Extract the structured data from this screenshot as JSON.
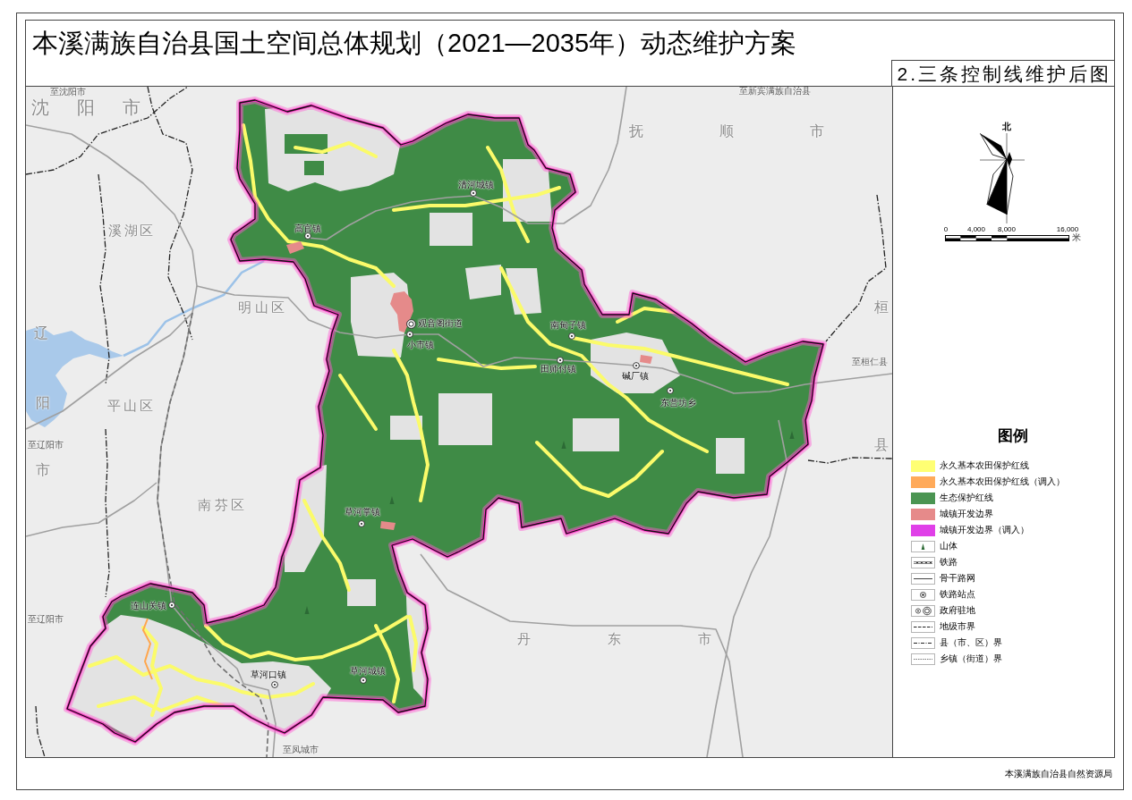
{
  "title": "本溪满族自治县国土空间总体规划（2021—2035年）动态维护方案",
  "subtitle": "2.三条控制线维护后图",
  "map": {
    "region_labels": [
      "沈阳市",
      "溪湖区",
      "明山区",
      "辽",
      "阳",
      "市",
      "平山区",
      "南芬区",
      "抚顺市",
      "丹东市",
      "桓",
      "县"
    ],
    "road_destinations": [
      "至沈阳市",
      "至新宾满族自治县",
      "至桓仁县",
      "至辽阳市",
      "至辽阳市",
      "至凤城市"
    ],
    "towns": [
      {
        "name": "清河城镇",
        "kind": "town"
      },
      {
        "name": "高官镇",
        "kind": "town"
      },
      {
        "name": "观音阁街道",
        "kind": "county_seat"
      },
      {
        "name": "小市镇",
        "kind": "town"
      },
      {
        "name": "南甸子镇",
        "kind": "town"
      },
      {
        "name": "田师付镇",
        "kind": "town"
      },
      {
        "name": "碱厂镇",
        "kind": "town"
      },
      {
        "name": "东营坊乡",
        "kind": "town"
      },
      {
        "name": "草河掌镇",
        "kind": "town"
      },
      {
        "name": "连山关镇",
        "kind": "town"
      },
      {
        "name": "草河口镇",
        "kind": "town"
      },
      {
        "name": "草河城镇",
        "kind": "town"
      }
    ]
  },
  "north_arrow": {
    "label": "北"
  },
  "scale_bar": {
    "ticks": [
      "0",
      "4,000",
      "8,000",
      "16,000"
    ],
    "unit": "米"
  },
  "legend": {
    "title": "图例",
    "items": [
      {
        "kind": "fill",
        "label": "永久基本农田保护红线",
        "color": "#ffff73"
      },
      {
        "kind": "fill",
        "label": "永久基本农田保护红线（调入）",
        "color": "#ffaa5a"
      },
      {
        "kind": "fill",
        "label": "生态保护红线",
        "color": "#4b9552"
      },
      {
        "kind": "fill",
        "label": "城镇开发边界",
        "color": "#e68a8a"
      },
      {
        "kind": "fill",
        "label": "城镇开发边界（调入）",
        "color": "#e040e8"
      },
      {
        "kind": "mountain",
        "label": "山体"
      },
      {
        "kind": "railway",
        "label": "铁路"
      },
      {
        "kind": "road",
        "label": "骨干路网"
      },
      {
        "kind": "station",
        "label": "铁路站点"
      },
      {
        "kind": "government",
        "label": "政府驻地"
      },
      {
        "kind": "city_boundary",
        "label": "地级市界"
      },
      {
        "kind": "county_boundary",
        "label": "县（市、区）界"
      },
      {
        "kind": "town_boundary",
        "label": "乡镇（街道）界"
      }
    ]
  },
  "publisher": "本溪满族自治县自然资源局"
}
